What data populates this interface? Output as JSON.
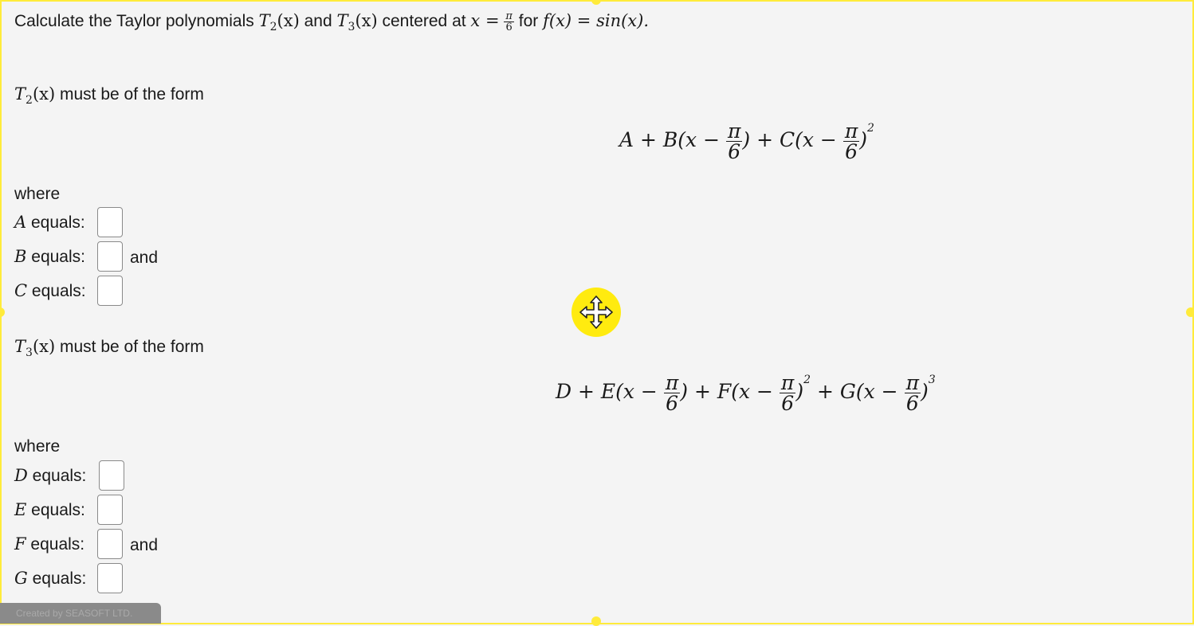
{
  "question": {
    "prefix": "Calculate the Taylor polynomials ",
    "and": " and ",
    "centered": " centered at ",
    "for": " for ",
    "T2": "T",
    "T2_sub": "2",
    "T3": "T",
    "T3_sub": "3",
    "x_arg": "(x)",
    "x_eq": "x =",
    "pi": "π",
    "six": "6",
    "f_eq": "f(x) = sin(x)."
  },
  "part1": {
    "label_T": "T",
    "label_sub": "2",
    "label_arg": "(x)",
    "label_text": " must be of the form",
    "formula": {
      "t1": "A + B(x −",
      "t2": ") + C(x −",
      "t3": ")",
      "exp": "2",
      "pi": "π",
      "six": "6"
    },
    "where": "where",
    "rows": [
      {
        "var": "A",
        "text": " equals:",
        "suffix": ""
      },
      {
        "var": "B",
        "text": " equals:",
        "suffix": "and"
      },
      {
        "var": "C",
        "text": " equals:",
        "suffix": ""
      }
    ]
  },
  "part2": {
    "label_T": "T",
    "label_sub": "3",
    "label_arg": "(x)",
    "label_text": " must be of the form",
    "formula": {
      "t1": "D + E(x −",
      "t2": ") + F(x −",
      "t3": ")",
      "exp2": "2",
      "t4": " + G(x −",
      "t5": ")",
      "exp3": "3",
      "pi": "π",
      "six": "6"
    },
    "where": "where",
    "rows": [
      {
        "var": "D",
        "text": " equals:",
        "suffix": ""
      },
      {
        "var": "E",
        "text": " equals:",
        "suffix": ""
      },
      {
        "var": "F",
        "text": " equals:",
        "suffix": "and"
      },
      {
        "var": "G",
        "text": " equals:",
        "suffix": ""
      }
    ]
  },
  "footer": {
    "text": "Created by SEASOFT LTD."
  },
  "colors": {
    "accent": "#ffeb3b",
    "background": "#f4f4f4"
  },
  "icons": {
    "move": "move-arrows-icon"
  }
}
